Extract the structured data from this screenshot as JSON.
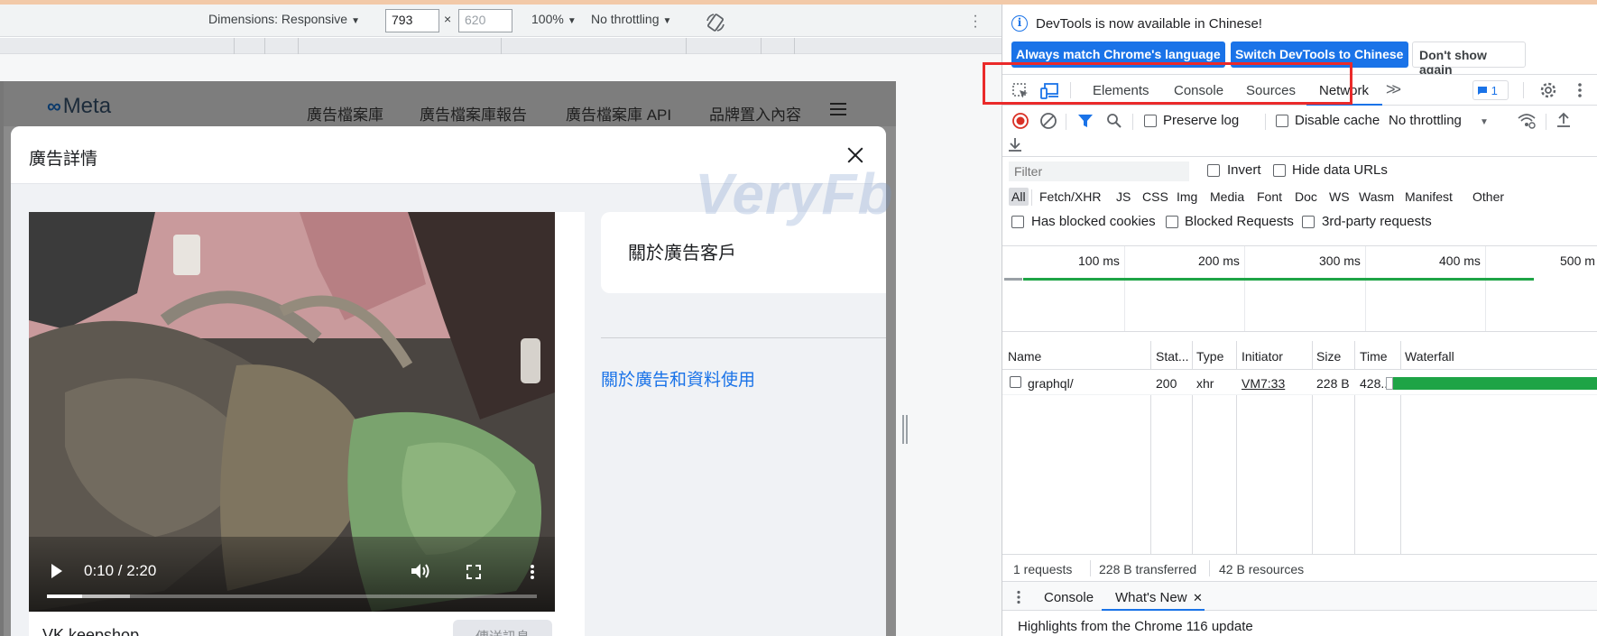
{
  "device_toolbar": {
    "dimensions_label": "Dimensions: Responsive",
    "width": "793",
    "height": "620",
    "times": "×",
    "zoom": "100%",
    "throttling": "No throttling"
  },
  "page": {
    "logo_text": "Meta",
    "nav": [
      "廣告檔案庫",
      "廣告檔案庫報告",
      "廣告檔案庫 API",
      "品牌置入內容"
    ]
  },
  "modal": {
    "title": "廣告詳情",
    "video": {
      "time": "0:10 / 2:20",
      "progress_fraction": 0.072,
      "buffered_fraction": 0.17
    },
    "advertiser": "VK keepshop",
    "send_button": "傳送訊息",
    "about_title": "關於廣告客戶",
    "about_link": "關於廣告和資料使用",
    "watermark": "VeryFb"
  },
  "devtools": {
    "info": {
      "text": "DevTools is now available in Chinese!",
      "btn_match": "Always match Chrome's language",
      "btn_switch": "Switch DevTools to Chinese",
      "btn_dismiss": "Don't show again"
    },
    "tabs": [
      "Elements",
      "Console",
      "Sources",
      "Network"
    ],
    "active_tab": "Network",
    "message_count": "1",
    "network_toolbar": {
      "preserve_log": "Preserve log",
      "disable_cache": "Disable cache",
      "throttling": "No throttling"
    },
    "filter": {
      "placeholder": "Filter",
      "invert": "Invert",
      "hide_data_urls": "Hide data URLs"
    },
    "types": [
      "All",
      "Fetch/XHR",
      "JS",
      "CSS",
      "Img",
      "Media",
      "Font",
      "Doc",
      "WS",
      "Wasm",
      "Manifest",
      "Other"
    ],
    "blocked": {
      "has_blocked_cookies": "Has blocked cookies",
      "blocked_requests": "Blocked Requests",
      "third_party": "3rd-party requests"
    },
    "overview_ticks": [
      "100 ms",
      "200 ms",
      "300 ms",
      "400 ms",
      "500 m"
    ],
    "columns": [
      "Name",
      "Stat...",
      "Type",
      "Initiator",
      "Size",
      "Time",
      "Waterfall"
    ],
    "rows": [
      {
        "name": "graphql/",
        "status": "200",
        "type": "xhr",
        "initiator": "VM7:33",
        "size": "228 B",
        "time": "428..."
      }
    ],
    "summary": {
      "requests": "1 requests",
      "transferred": "228 B transferred",
      "resources": "42 B resources"
    },
    "drawer": {
      "tabs": [
        "Console",
        "What's New"
      ],
      "active": "What's New",
      "close": "✕",
      "body": "Highlights from the Chrome 116 update"
    }
  }
}
